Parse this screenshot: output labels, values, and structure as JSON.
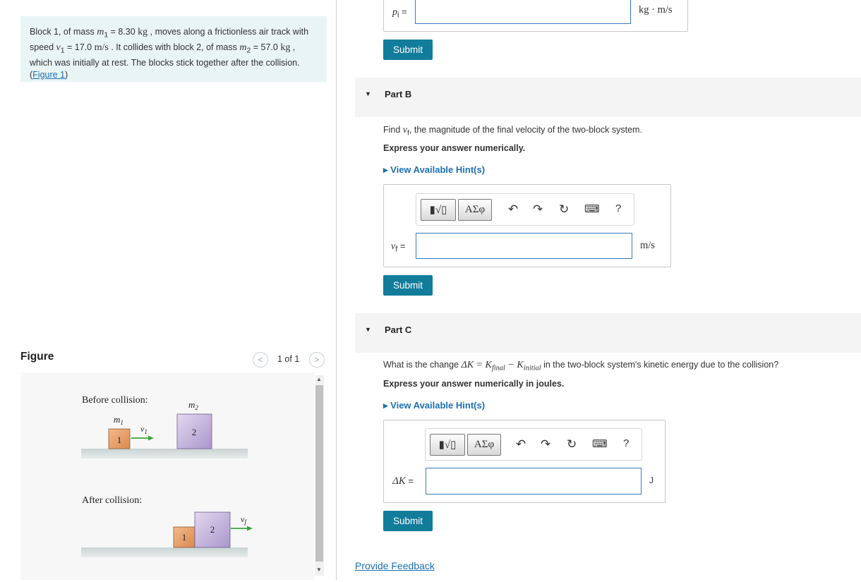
{
  "problem": {
    "t1": "Block 1, of mass ",
    "m1_sym": "m",
    "m1_sub": "1",
    "t2": " = 8.30 ",
    "kg1": "kg",
    "t3": " , moves along a frictionless air track with speed ",
    "v1_sym": "v",
    "v1_sub": "1",
    "t4": " = 17.0 ",
    "ms": "m/s",
    "t5": " . It collides with block 2, of mass ",
    "m2_sym": "m",
    "m2_sub": "2",
    "t6": " = 57.0 ",
    "kg2": "kg",
    "t7": " , which was initially at rest. The blocks stick together after the collision. (",
    "link": "Figure 1",
    "t8": ")"
  },
  "figure": {
    "title": "Figure",
    "pager": "1 of 1",
    "prev_icon": "chevron-left-icon",
    "next_icon": "chevron-right-icon",
    "before_label": "Before collision:",
    "after_label": "After collision:",
    "m1": "m",
    "m1_sub": "1",
    "m2": "m",
    "m2_sub": "2",
    "v1": "v",
    "v1_sub": "1",
    "vf": "v",
    "vf_sub": "f",
    "block1": "1",
    "block2": "2",
    "block1_color": "#e8a36c",
    "block2_color": "#c6b3df",
    "arrow_color": "#3aa53a"
  },
  "part_a": {
    "var": "p",
    "var_sub": "i",
    "eq": " =",
    "unit": "kg · m/s",
    "submit": "Submit"
  },
  "part_b": {
    "title": "Part B",
    "q1": "Find ",
    "q_var": "v",
    "q_sub": "f",
    "q2": ", the magnitude of the final velocity of the two-block system.",
    "instruction": "Express your answer numerically.",
    "hint": "View Available Hint(s)",
    "var": "v",
    "var_sub": "f",
    "eq": " =",
    "unit": "m/s",
    "submit": "Submit"
  },
  "part_c": {
    "title": "Part C",
    "q1": "What is the change ",
    "q_expr": "ΔK = K",
    "q_sub1": "final",
    "q_mid": " − K",
    "q_sub2": "initial",
    "q2": " in the two-block system's kinetic energy due to the collision?",
    "instruction": "Express your answer numerically in joules.",
    "hint": "View Available Hint(s)",
    "var": "ΔK",
    "eq": " =",
    "unit": "J",
    "submit": "Submit"
  },
  "toolbar": {
    "template_btn": "▮√▯",
    "greek_btn": "ΑΣφ",
    "undo": "↶",
    "redo": "↷",
    "reset": "↻",
    "keyboard": "⌨",
    "help": "?"
  },
  "feedback": "Provide Feedback"
}
